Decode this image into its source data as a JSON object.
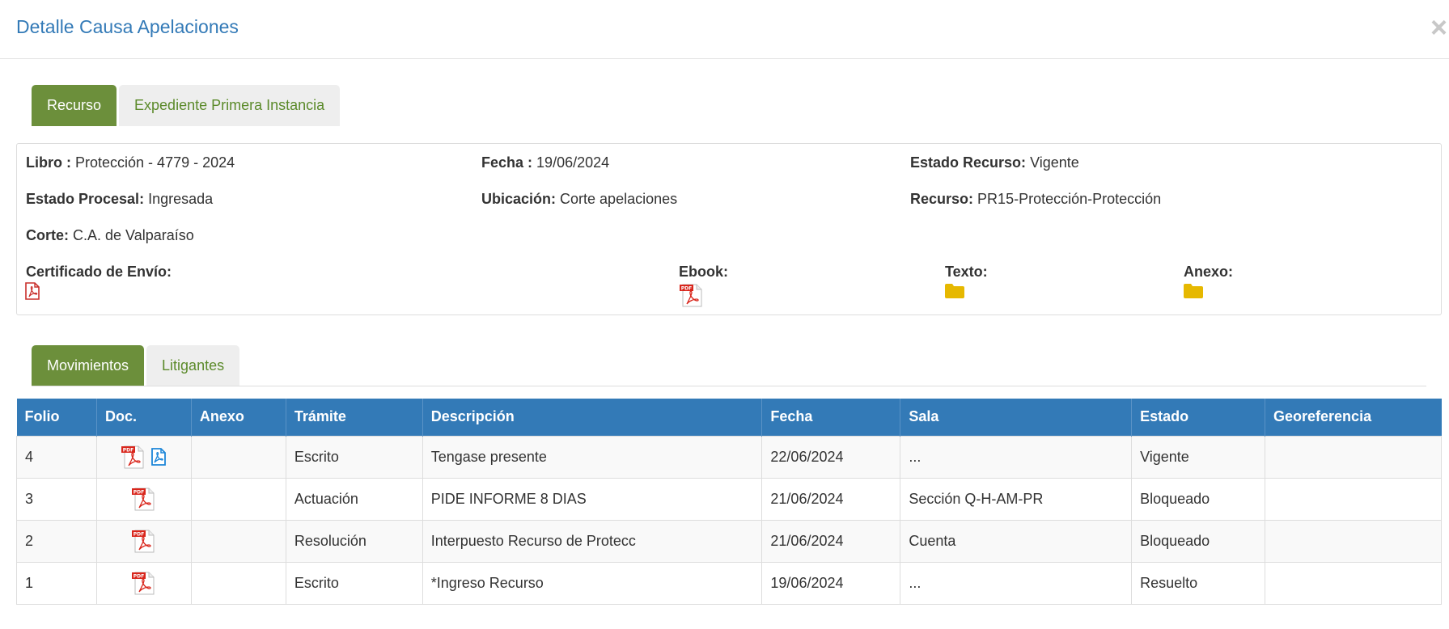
{
  "modal": {
    "title": "Detalle Causa Apelaciones",
    "close": "×"
  },
  "top_tabs": [
    {
      "label": "Recurso",
      "active": true
    },
    {
      "label": "Expediente Primera Instancia",
      "active": false
    }
  ],
  "info": {
    "libro": {
      "label": "Libro :",
      "value": "Protección - 4779 - 2024"
    },
    "fecha": {
      "label": "Fecha :",
      "value": "19/06/2024"
    },
    "estado_recurso": {
      "label": "Estado Recurso:",
      "value": "Vigente"
    },
    "estado_procesal": {
      "label": "Estado Procesal:",
      "value": "Ingresada"
    },
    "ubicacion": {
      "label": "Ubicación:",
      "value": "Corte apelaciones"
    },
    "recurso": {
      "label": "Recurso:",
      "value": "PR15-Protección-Protección"
    },
    "corte": {
      "label": "Corte:",
      "value": "C.A. de Valparaíso"
    },
    "certificado": {
      "label": "Certificado de Envío:",
      "icon": "pdf-outline-icon"
    },
    "ebook": {
      "label": "Ebook:",
      "icon": "pdf-file-icon"
    },
    "texto": {
      "label": "Texto:",
      "icon": "folder-icon"
    },
    "anexo": {
      "label": "Anexo:",
      "icon": "folder-icon"
    }
  },
  "bottom_tabs": [
    {
      "label": "Movimientos",
      "active": true
    },
    {
      "label": "Litigantes",
      "active": false
    }
  ],
  "table": {
    "headers": [
      "Folio",
      "Doc.",
      "Anexo",
      "Trámite",
      "Descripción",
      "Fecha",
      "Sala",
      "Estado",
      "Georeferencia"
    ],
    "rows": [
      {
        "folio": "4",
        "docs": [
          "pdf-file-icon",
          "pdf-blue-icon"
        ],
        "anexo": "",
        "tramite": "Escrito",
        "descripcion": "Tengase presente",
        "fecha": "22/06/2024",
        "sala": "...",
        "estado": "Vigente",
        "geo": ""
      },
      {
        "folio": "3",
        "docs": [
          "pdf-file-icon"
        ],
        "anexo": "",
        "tramite": "Actuación",
        "descripcion": "PIDE INFORME 8 DIAS",
        "fecha": "21/06/2024",
        "sala": "Sección Q-H-AM-PR",
        "estado": "Bloqueado",
        "geo": ""
      },
      {
        "folio": "2",
        "docs": [
          "pdf-file-icon"
        ],
        "anexo": "",
        "tramite": "Resolución",
        "descripcion": "Interpuesto Recurso de Protecc",
        "fecha": "21/06/2024",
        "sala": "Cuenta",
        "estado": "Bloqueado",
        "geo": ""
      },
      {
        "folio": "1",
        "docs": [
          "pdf-file-icon"
        ],
        "anexo": "",
        "tramite": "Escrito",
        "descripcion": "*Ingreso Recurso",
        "fecha": "19/06/2024",
        "sala": "...",
        "estado": "Resuelto",
        "geo": ""
      }
    ]
  },
  "colors": {
    "title_blue": "#337ab7",
    "tab_active_green": "#6c8f3b",
    "tab_inactive_text": "#5b8a2a",
    "table_header_blue": "#337ab7",
    "pdf_red": "#d9261c",
    "folder_yellow": "#e6b800"
  }
}
